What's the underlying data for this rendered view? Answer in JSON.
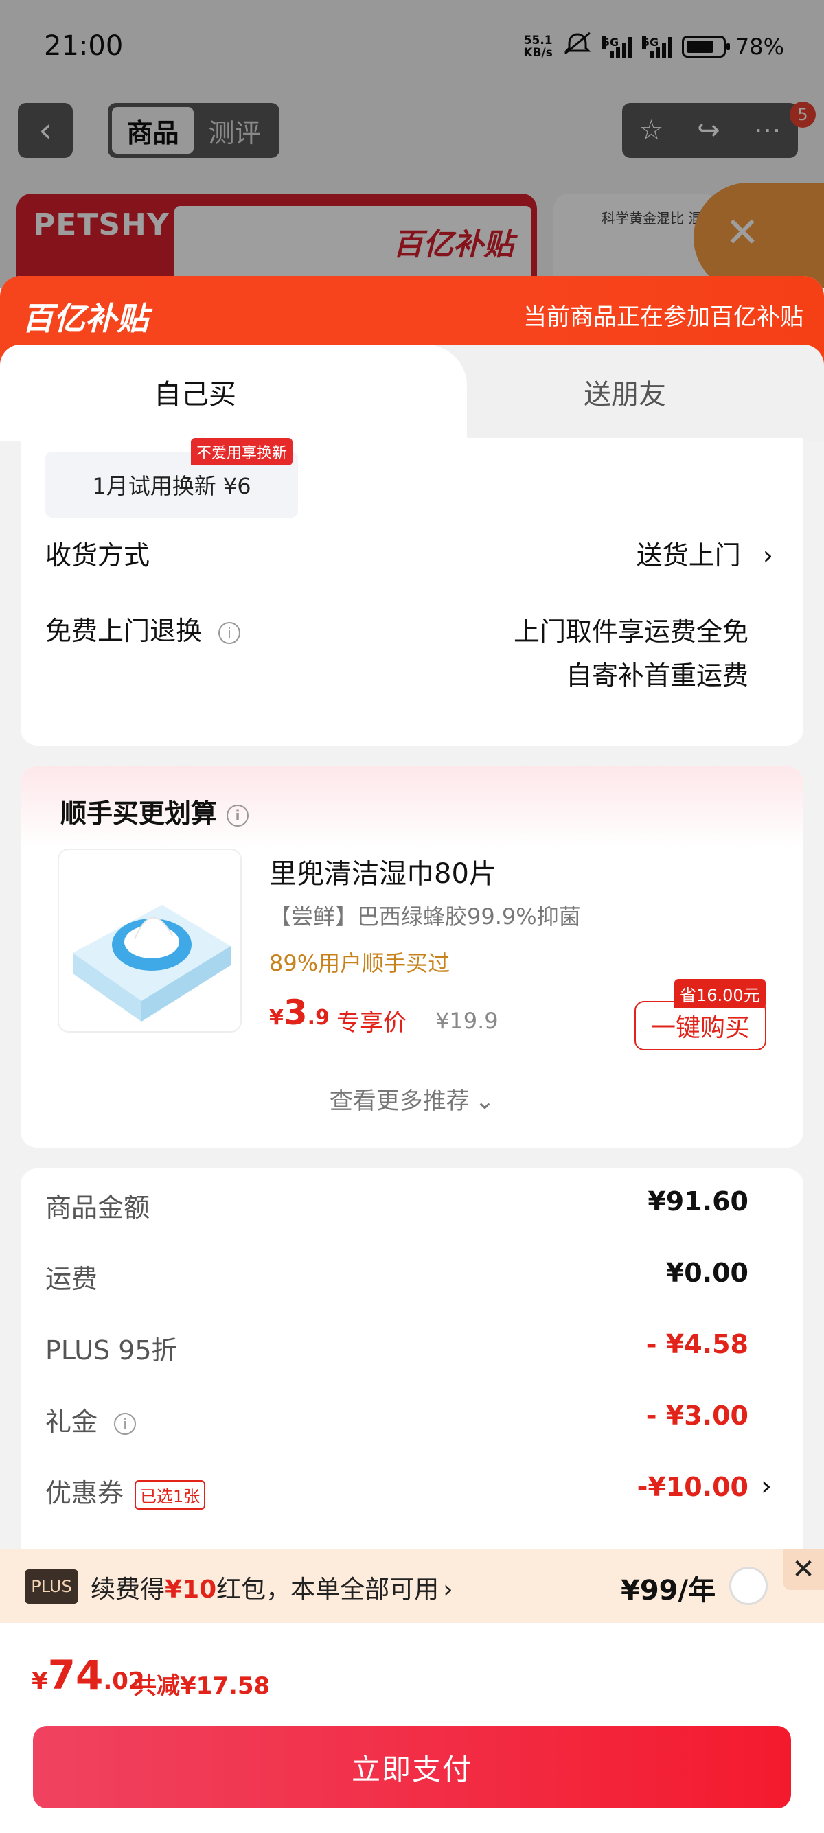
{
  "status_bar": {
    "time": "21:00",
    "net_speed_value": "55.1",
    "net_speed_unit": "KB/s",
    "signal1_label": "5G",
    "signal2_label": "5G",
    "battery": "78%"
  },
  "top_nav": {
    "back_icon": "chevron-left-icon",
    "tabs": [
      {
        "label": "商品",
        "active": true
      },
      {
        "label": "测评",
        "active": false
      }
    ],
    "right_icons": [
      "star-icon",
      "share-icon",
      "more-icon"
    ],
    "badge_count": "5"
  },
  "background": {
    "banner_brand": "PETSHY",
    "banner_promo": "百亿补贴",
    "card2_text": "科学黄金混比 混"
  },
  "promo_header": {
    "logo": "百亿补贴",
    "text": "当前商品正在参加百亿补贴"
  },
  "order_tabs": [
    {
      "label": "自己买",
      "active": true
    },
    {
      "label": "送朋友",
      "active": false
    }
  ],
  "service_card": {
    "trial_label": "1月试用换新 ¥6",
    "trial_tag": "不爱用享换新",
    "delivery_label": "收货方式",
    "delivery_value": "送货上门",
    "return_label": "免费上门退换",
    "return_value_line1": "上门取件享运费全免",
    "return_value_line2": "自寄补首重运费"
  },
  "addon_card": {
    "title": "顺手买更划算",
    "product": {
      "name": "里兜清洁湿巾80片",
      "desc": "【尝鲜】巴西绿蜂胶99.9%抑菌",
      "buy_stat": "89%用户顺手买过",
      "price_yen": "¥",
      "price_int": "3",
      "price_dec": ".9",
      "price_label": "专享价",
      "original_price": "¥19.9",
      "save_tag": "省16.00元",
      "buy_button": "一键购买"
    },
    "more": "查看更多推荐"
  },
  "summary": {
    "rows": [
      {
        "label": "商品金额",
        "value": "¥91.60",
        "red": false
      },
      {
        "label": "运费",
        "value": "¥0.00",
        "red": false
      },
      {
        "label": "PLUS 95折",
        "value": "- ¥4.58",
        "red": true
      },
      {
        "label": "礼金",
        "value": "- ¥3.00",
        "red": true
      },
      {
        "label": "优惠券",
        "value": "-¥10.00",
        "red": true
      }
    ],
    "coupon_tag": "已选1张"
  },
  "plus_bar": {
    "badge": "PLUS",
    "text_prefix": "续费得",
    "text_amount": "¥10",
    "text_suffix": "红包，本单全部可用",
    "price": "¥99/年"
  },
  "checkout": {
    "total_yen": "¥",
    "total_int": "74",
    "total_dec": ".02",
    "total_saving": "共减¥17.58",
    "pay_button": "立即支付"
  },
  "colors": {
    "accent_red": "#e2231a",
    "promo_orange": "#f6441c",
    "plus_bg": "#fdebdc"
  }
}
